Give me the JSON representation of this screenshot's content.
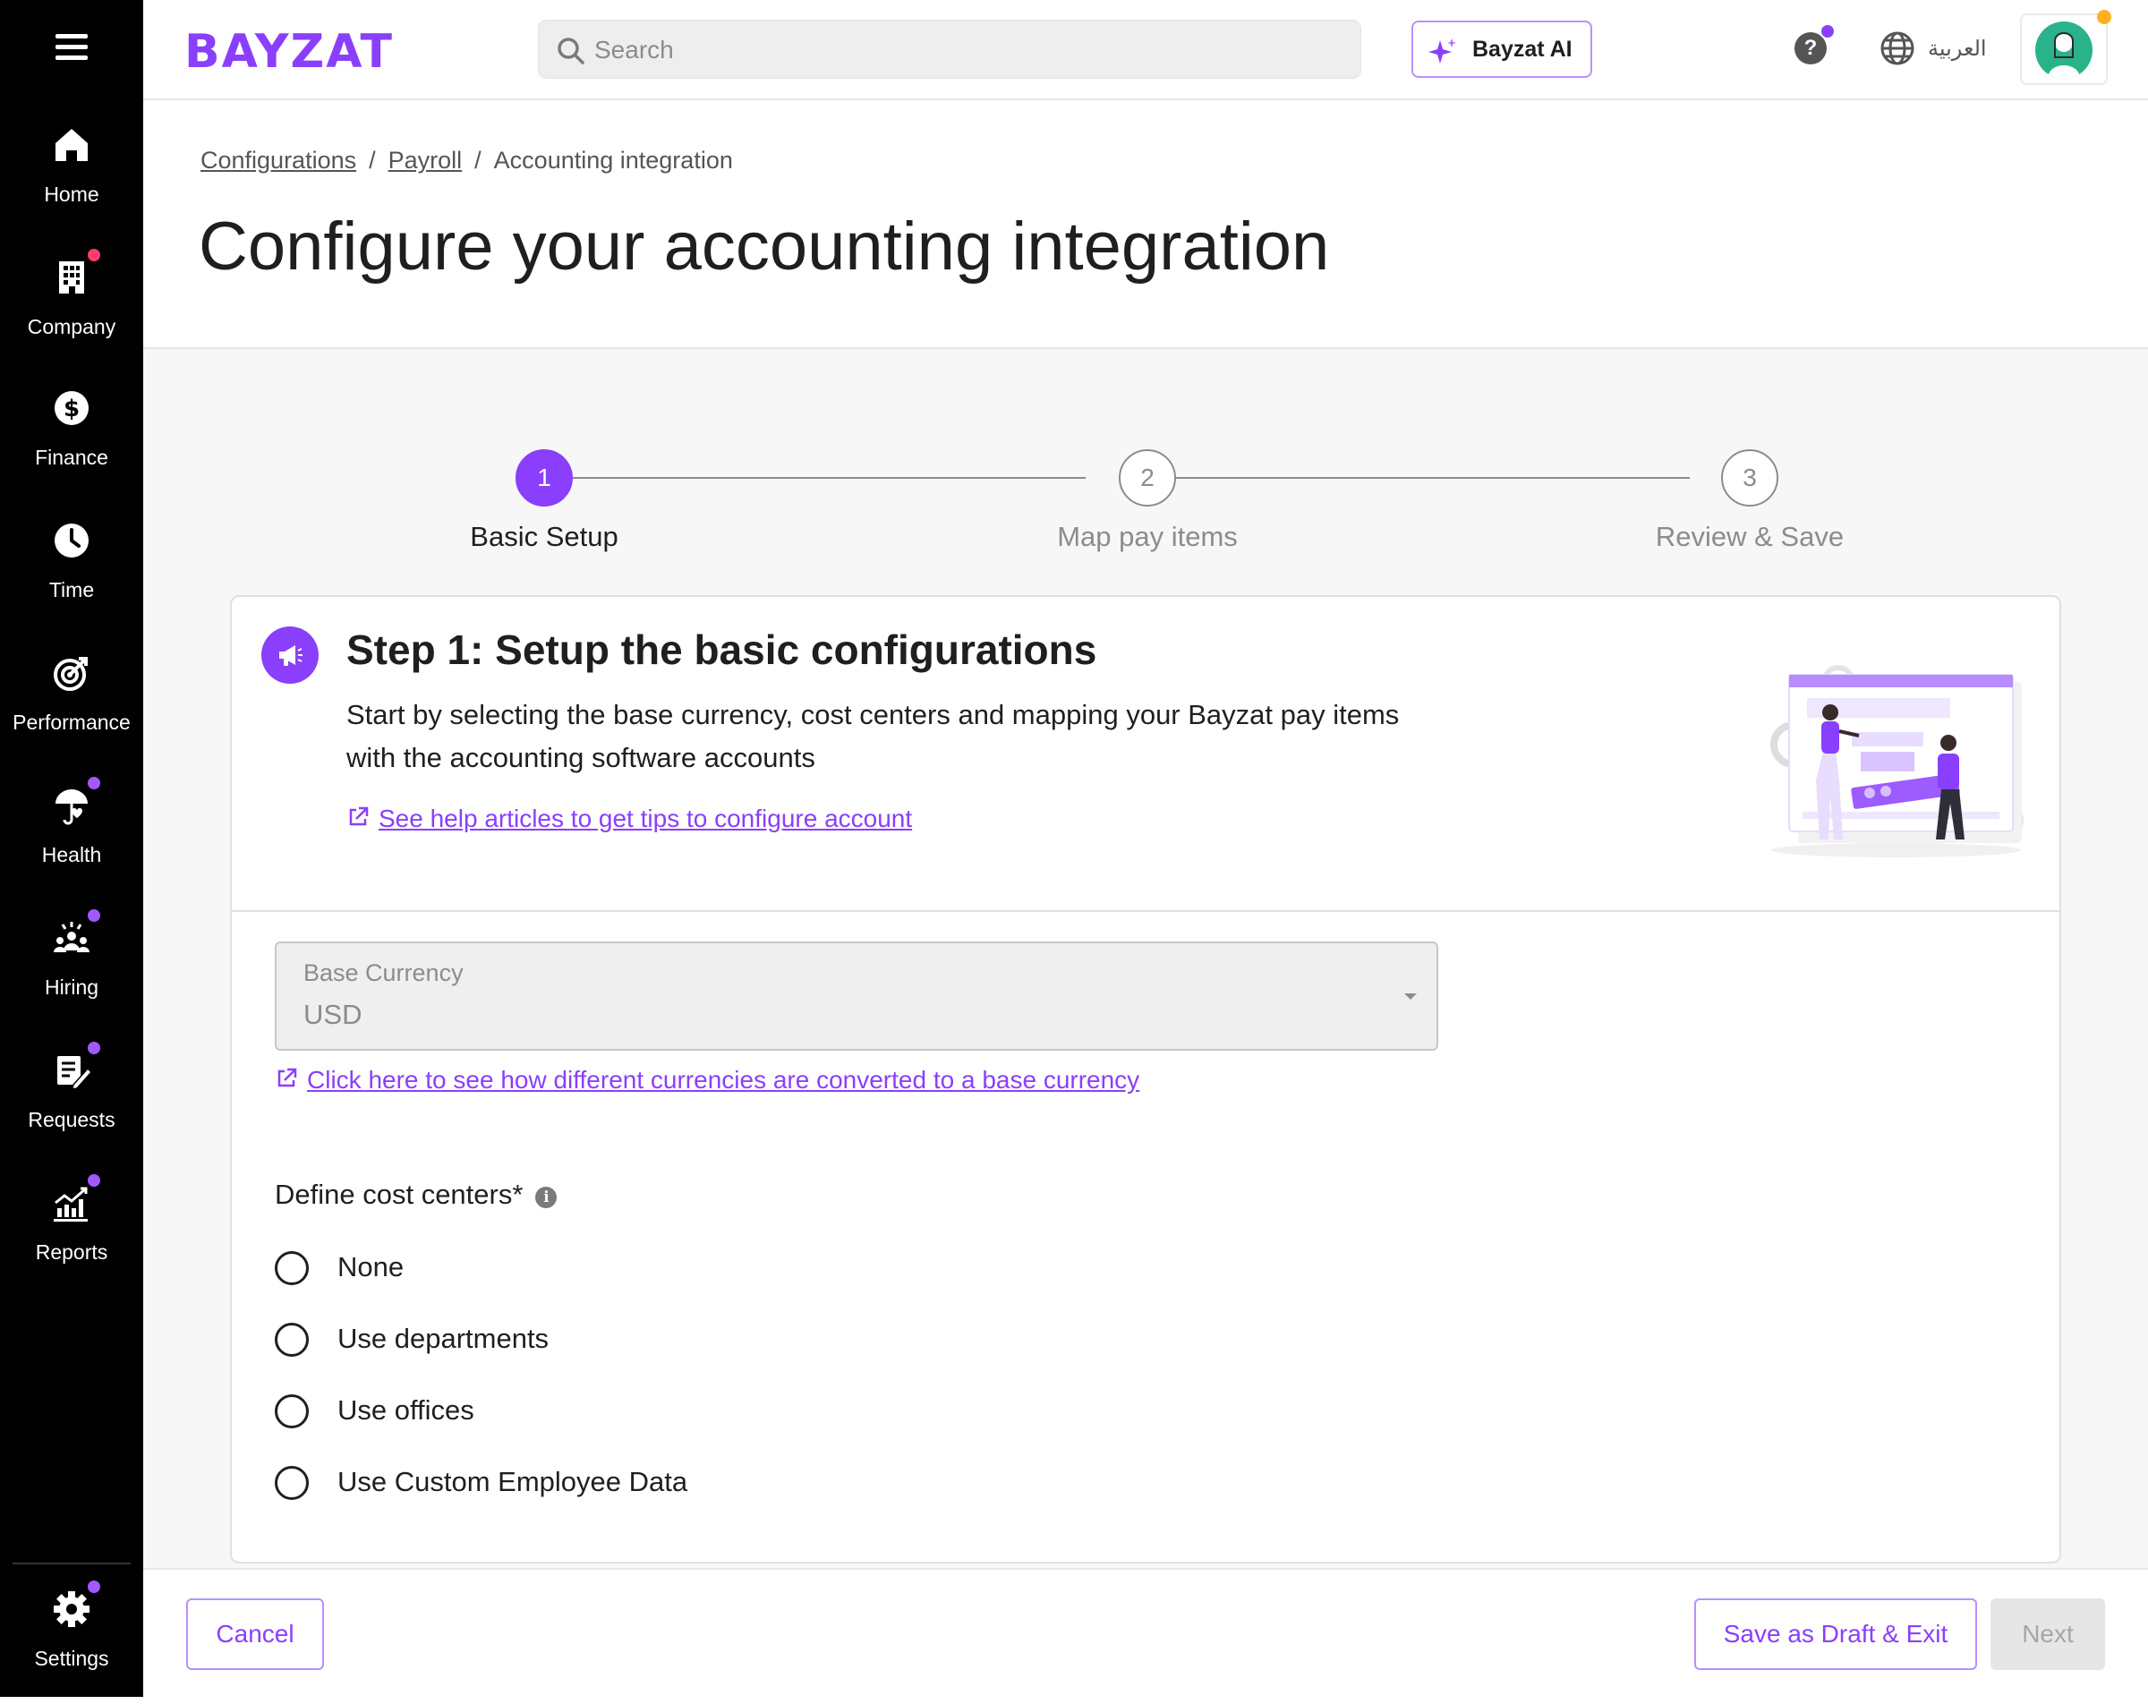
{
  "app": {
    "logo": "BAYZAT",
    "brand_color": "#8a3ffc"
  },
  "sidebar": {
    "menu_icon": "hamburger-icon",
    "items": [
      {
        "label": "Home",
        "icon": "home-icon",
        "badge": false
      },
      {
        "label": "Company",
        "icon": "building-icon",
        "badge": true,
        "badge_color": "#ff3d6f"
      },
      {
        "label": "Finance",
        "icon": "dollar-icon",
        "badge": false
      },
      {
        "label": "Time",
        "icon": "clock-icon",
        "badge": false
      },
      {
        "label": "Performance",
        "icon": "target-icon",
        "badge": false
      },
      {
        "label": "Health",
        "icon": "umbrella-heart-icon",
        "badge": true,
        "badge_color": "#a058ff"
      },
      {
        "label": "Hiring",
        "icon": "people-icon",
        "badge": true,
        "badge_color": "#a058ff"
      },
      {
        "label": "Requests",
        "icon": "clipboard-edit-icon",
        "badge": true,
        "badge_color": "#a058ff"
      },
      {
        "label": "Reports",
        "icon": "chart-icon",
        "badge": true,
        "badge_color": "#a058ff"
      }
    ],
    "settings": {
      "label": "Settings",
      "icon": "gear-icon",
      "badge": true
    }
  },
  "header": {
    "search_placeholder": "Search",
    "ai_button": "Bayzat AI",
    "help_label": "?",
    "language_label": "العربية"
  },
  "breadcrumb": {
    "items": [
      "Configurations",
      "Payroll"
    ],
    "current": "Accounting integration",
    "separator": "/"
  },
  "page": {
    "title": "Configure your accounting integration"
  },
  "stepper": {
    "steps": [
      {
        "number": "1",
        "label": "Basic Setup",
        "active": true
      },
      {
        "number": "2",
        "label": "Map pay items",
        "active": false
      },
      {
        "number": "3",
        "label": "Review & Save",
        "active": false
      }
    ]
  },
  "card": {
    "title": "Step 1: Setup the basic configurations",
    "description": "Start by selecting the base currency, cost centers and mapping your Bayzat pay items with the accounting software accounts",
    "help_link": "See help articles to get tips to configure account",
    "currency": {
      "label": "Base Currency",
      "value": "USD"
    },
    "conversion_link": "Click here to see how different currencies are converted to a base currency",
    "cost_centers": {
      "title": "Define cost centers*",
      "info": "i",
      "options": [
        "None",
        "Use departments",
        "Use offices",
        "Use Custom Employee Data"
      ]
    }
  },
  "footer": {
    "cancel": "Cancel",
    "save_draft": "Save as Draft & Exit",
    "next": "Next"
  }
}
